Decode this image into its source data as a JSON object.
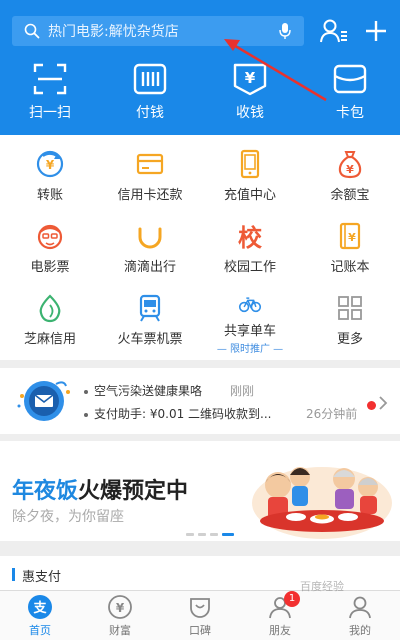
{
  "search": {
    "placeholder": "热门电影:解忧杂货店",
    "icons": [
      "search-icon",
      "microphone-icon"
    ]
  },
  "header_actions": [
    "contacts-icon",
    "plus-icon"
  ],
  "quick_actions": [
    {
      "label": "扫一扫",
      "icon": "scan-icon"
    },
    {
      "label": "付钱",
      "icon": "barcode-icon"
    },
    {
      "label": "收钱",
      "icon": "receive-money-icon"
    },
    {
      "label": "卡包",
      "icon": "card-wallet-icon"
    }
  ],
  "services": [
    {
      "label": "转账",
      "icon": "transfer-icon",
      "color": "#2f8fe8"
    },
    {
      "label": "信用卡还款",
      "icon": "credit-card-icon",
      "color": "#f5a623"
    },
    {
      "label": "充值中心",
      "icon": "phone-recharge-icon",
      "color": "#f5a623"
    },
    {
      "label": "余额宝",
      "icon": "money-bag-icon",
      "color": "#ee5a36"
    },
    {
      "label": "电影票",
      "icon": "movie-ticket-icon",
      "color": "#ee5a36"
    },
    {
      "label": "滴滴出行",
      "icon": "didi-icon",
      "color": "#f5a623"
    },
    {
      "label": "校园工作",
      "icon": "campus-icon",
      "color": "#ee5a36",
      "glyph": "校"
    },
    {
      "label": "记账本",
      "icon": "ledger-icon",
      "color": "#f5a623"
    },
    {
      "label": "芝麻信用",
      "icon": "sesame-credit-icon",
      "color": "#3cb371"
    },
    {
      "label": "火车票机票",
      "icon": "train-icon",
      "color": "#2f8fe8"
    },
    {
      "label": "共享单车",
      "icon": "bicycle-icon",
      "color": "#2f8fe8",
      "sub": "— 限时推广 —"
    },
    {
      "label": "更多",
      "icon": "more-grid-icon",
      "color": "#999999"
    }
  ],
  "news": {
    "items": [
      {
        "text": "空气污染送健康果咯",
        "time": "刚刚"
      },
      {
        "text": "支付助手: ¥0.01 二维码收款到...",
        "time": "26分钟前"
      }
    ]
  },
  "banner": {
    "title_highlight": "年夜饭",
    "title_rest": "火爆预定中",
    "subtitle": "除夕夜，为你留座"
  },
  "section": {
    "title": "惠支付"
  },
  "tabs": [
    {
      "label": "首页",
      "icon": "home-pay-icon",
      "active": true
    },
    {
      "label": "财富",
      "icon": "wealth-icon"
    },
    {
      "label": "口碑",
      "icon": "koubei-icon"
    },
    {
      "label": "朋友",
      "icon": "friends-icon",
      "badge": "1"
    },
    {
      "label": "我的",
      "icon": "profile-icon"
    }
  ],
  "watermark": "百度经验",
  "colors": {
    "brand": "#1a88e8",
    "badge": "#f23030",
    "arrow": "#e8322e"
  }
}
